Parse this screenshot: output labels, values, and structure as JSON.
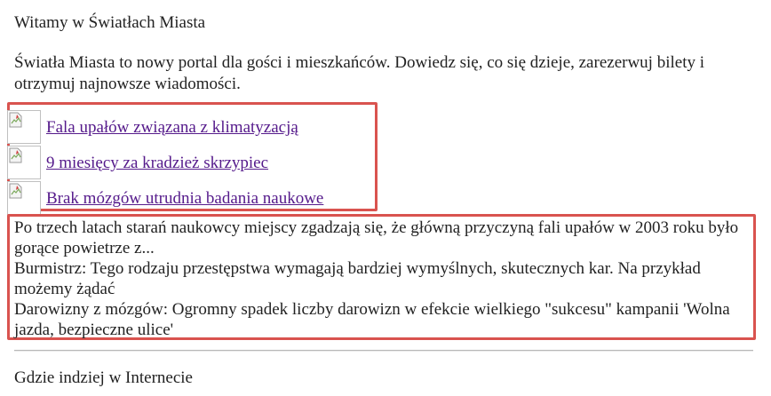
{
  "page": {
    "title": "Witamy w Światłach Miasta",
    "intro": "Światła Miasta to nowy portal dla gości i mieszkańców. Dowiedz się, co się dzieje, zarezerwuj bilety i otrzymuj najnowsze wiadomości."
  },
  "news": {
    "items": [
      {
        "label": "Fala upałów związana z klimatyzacją",
        "icon": "broken-image-icon"
      },
      {
        "label": "9 miesięcy za kradzież skrzypiec",
        "icon": "broken-image-icon"
      },
      {
        "label": "Brak mózgów utrudnia badania naukowe",
        "icon": "broken-image-icon"
      }
    ]
  },
  "descriptions": [
    "Po trzech latach starań naukowcy miejscy zgadzają się, że główną przyczyną fali upałów w 2003 roku było gorące powietrze z...",
    "Burmistrz: Tego rodzaju przestępstwa wymagają bardziej wymyślnych, skutecznych kar. Na przykład możemy żądać",
    "Darowizny z mózgów: Ogromny spadek liczby darowizn w efekcie wielkiego \"sukcesu\" kampanii 'Wolna jazda, bezpieczne ulice'"
  ],
  "footer": {
    "elsewhere": "Gdzie indziej w Internecie"
  },
  "colors": {
    "highlight_border": "#d9534f",
    "link_visited": "#551a8b",
    "text": "#222222"
  }
}
